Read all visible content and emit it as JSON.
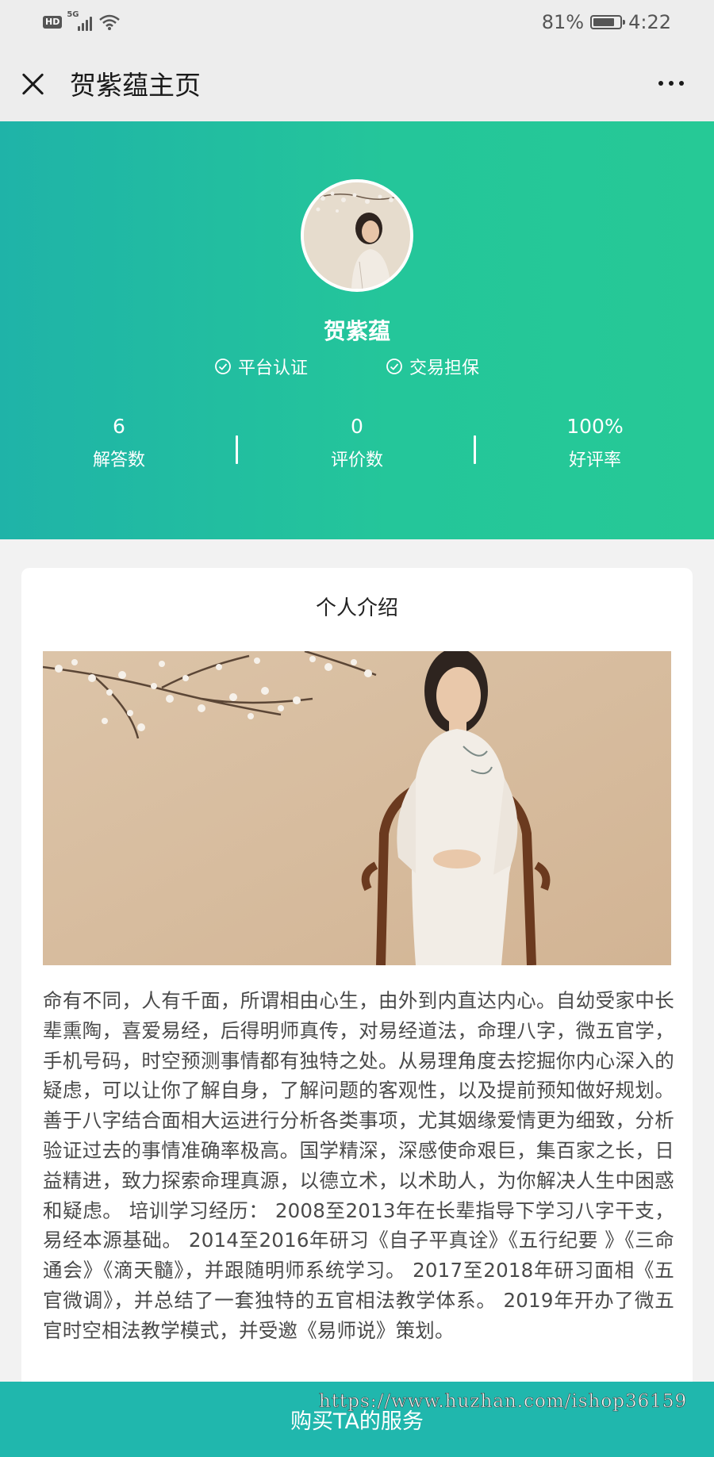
{
  "status_bar": {
    "hd": "HD",
    "network": "5G",
    "battery": "81%",
    "battery_level": 0.81,
    "time": "4:22"
  },
  "nav": {
    "title": "贺紫蕴主页",
    "close_icon": "close-icon",
    "more_icon": "more-icon"
  },
  "profile": {
    "name": "贺紫蕴",
    "badges": [
      "平台认证",
      "交易担保"
    ],
    "stats": [
      {
        "value": "6",
        "label": "解答数"
      },
      {
        "value": "0",
        "label": "评价数"
      },
      {
        "value": "100%",
        "label": "好评率"
      }
    ]
  },
  "intro": {
    "title": "个人介绍",
    "text": "命有不同，人有千面，所谓相由心生，由外到内直达内心。自幼受家中长辈熏陶，喜爱易经，后得明师真传，对易经道法，命理八字，微五官学，手机号码，时空预测事情都有独特之处。从易理角度去挖掘你内心深入的疑虑，可以让你了解自身，了解问题的客观性，以及提前预知做好规划。善于八字结合面相大运进行分析各类事项，尤其姻缘爱情更为细致，分析验证过去的事情准确率极高。国学精深，深感使命艰巨，集百家之长，日益精进，致力探索命理真源，以德立术，以术助人，为你解决人生中困惑和疑虑。 培训学习经历： 2008至2013年在长辈指导下学习八字干支，易经本源基础。 2014至2016年研习《自子平真诠》《五行纪要 》《三命通会》《滴天髓》，并跟随明师系统学习。 2017至2018年研习面相《五官微调》，并总结了一套独特的五官相法教学体系。 2019年开办了微五官时空相法教学模式，并受邀《易师说》策划。"
  },
  "footer": {
    "buy_label": "购买TA的服务",
    "watermark": "https://www.huzhan.com/ishop36159"
  },
  "colors": {
    "hero_start": "#1fb3a8",
    "hero_end": "#26c996",
    "buy_bar": "#20b7ad"
  }
}
